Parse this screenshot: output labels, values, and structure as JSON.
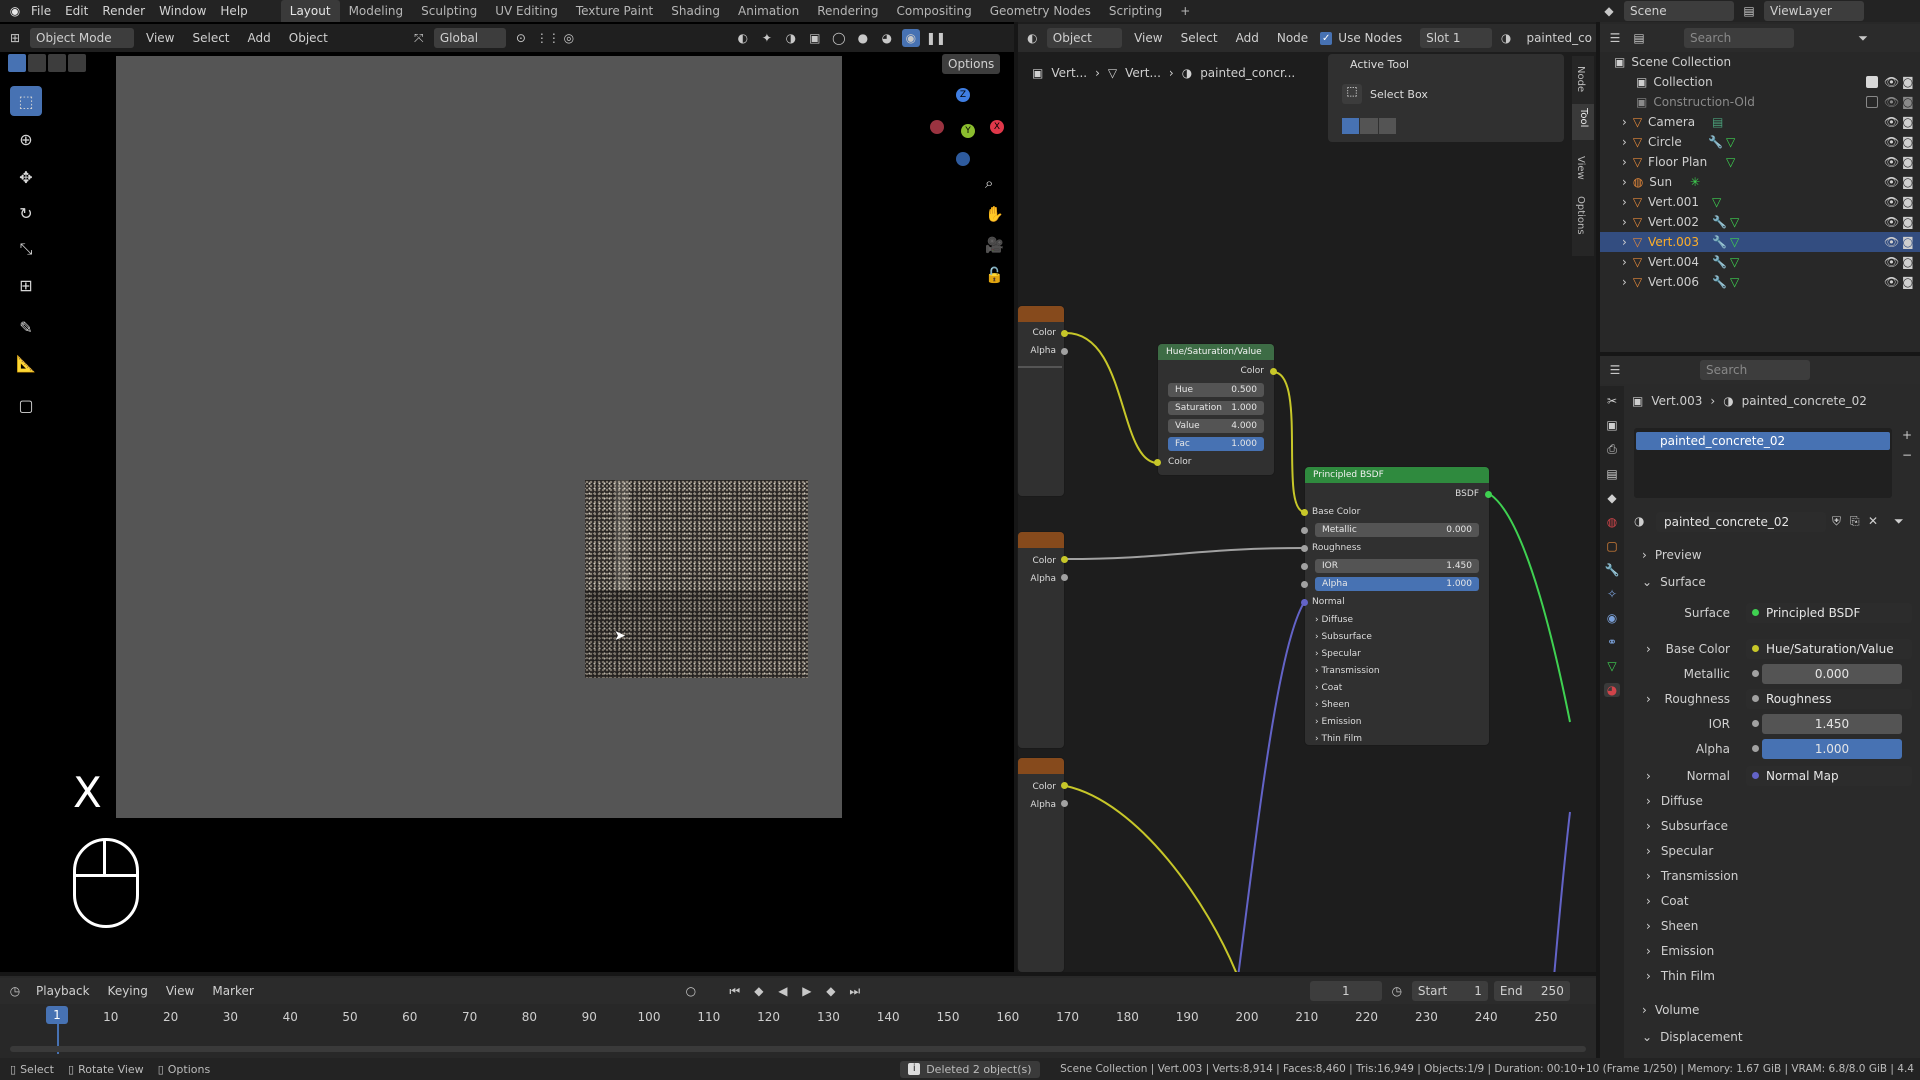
{
  "menus": [
    "File",
    "Edit",
    "Render",
    "Window",
    "Help"
  ],
  "workspaces": [
    "Layout",
    "Modeling",
    "Sculpting",
    "UV Editing",
    "Texture Paint",
    "Shading",
    "Animation",
    "Rendering",
    "Compositing",
    "Geometry Nodes",
    "Scripting"
  ],
  "scene_name": "Scene",
  "view_layer": "ViewLayer",
  "viewport": {
    "mode": "Object Mode",
    "menus": [
      "View",
      "Select",
      "Add",
      "Object"
    ],
    "transform": "Global",
    "options_label": "Options",
    "key_overlay": "X"
  },
  "node_editor": {
    "type": "Object",
    "menus": [
      "View",
      "Select",
      "Add",
      "Node"
    ],
    "use_nodes_label": "Use Nodes",
    "slot": "Slot 1",
    "material_short": "painted_co",
    "breadcrumb": [
      "Vert...",
      "Vert...",
      "painted_concr..."
    ],
    "tabs": [
      "Node",
      "Tool",
      "View",
      "Options"
    ],
    "active_tool": {
      "title": "Active Tool",
      "tool": "Select Box"
    },
    "texture_sockets": {
      "color": "Color",
      "alpha": "Alpha"
    },
    "hsv": {
      "title": "Hue/Saturation/Value",
      "out": "Color",
      "in_color": "Color",
      "fields": [
        {
          "label": "Hue",
          "value": "0.500"
        },
        {
          "label": "Saturation",
          "value": "1.000"
        },
        {
          "label": "Value",
          "value": "4.000"
        },
        {
          "label": "Fac",
          "value": "1.000"
        }
      ]
    },
    "bsdf": {
      "title": "Principled BSDF",
      "out": "BSDF",
      "base_color": "Base Color",
      "metallic": "Metallic",
      "metallic_value": "0.000",
      "roughness": "Roughness",
      "ior": "IOR",
      "ior_value": "1.450",
      "alpha": "Alpha",
      "alpha_value": "1.000",
      "normal": "Normal",
      "panels": [
        "Diffuse",
        "Subsurface",
        "Specular",
        "Transmission",
        "Coat",
        "Sheen",
        "Emission",
        "Thin Film"
      ]
    }
  },
  "outliner": {
    "search_placeholder": "Search",
    "root": "Scene Collection",
    "items": [
      {
        "name": "Collection"
      },
      {
        "name": "Construction-Old"
      },
      {
        "name": "Camera"
      },
      {
        "name": "Circle"
      },
      {
        "name": "Floor Plan"
      },
      {
        "name": "Sun"
      },
      {
        "name": "Vert.001"
      },
      {
        "name": "Vert.002"
      },
      {
        "name": "Vert.003"
      },
      {
        "name": "Vert.004"
      },
      {
        "name": "Vert.006"
      }
    ]
  },
  "properties": {
    "search_placeholder": "Search",
    "breadcrumb_object": "Vert.003",
    "breadcrumb_material": "painted_concrete_02",
    "slot_material": "painted_concrete_02",
    "material_name": "painted_concrete_02",
    "sections": {
      "preview": "Preview",
      "surface": "Surface",
      "volume": "Volume",
      "displacement": "Displacement"
    },
    "surface_label": "Surface",
    "surface_value": "Principled BSDF",
    "base_color_label": "Base Color",
    "base_color_value": "Hue/Saturation/Value",
    "metallic_label": "Metallic",
    "metallic_value": "0.000",
    "roughness_label": "Roughness",
    "roughness_value": "Roughness",
    "ior_label": "IOR",
    "ior_value": "1.450",
    "alpha_label": "Alpha",
    "alpha_value": "1.000",
    "normal_label": "Normal",
    "normal_value": "Normal Map",
    "subpanels": [
      "Diffuse",
      "Subsurface",
      "Specular",
      "Transmission",
      "Coat",
      "Sheen",
      "Emission",
      "Thin Film"
    ]
  },
  "timeline": {
    "menus": [
      "Playback",
      "Keying",
      "View",
      "Marker"
    ],
    "current_frame": "1",
    "start_label": "Start",
    "start": "1",
    "end_label": "End",
    "end": "250",
    "ticks": [
      "1",
      "10",
      "20",
      "30",
      "40",
      "50",
      "60",
      "70",
      "80",
      "90",
      "100",
      "110",
      "120",
      "130",
      "140",
      "150",
      "160",
      "170",
      "180",
      "190",
      "200",
      "210",
      "220",
      "230",
      "240",
      "250"
    ]
  },
  "status": {
    "select": "Select",
    "rotate": "Rotate View",
    "options": "Options",
    "message": "Deleted 2 object(s)",
    "info": "Scene Collection | Vert.003 | Verts:8,914 | Faces:8,460 | Tris:16,949 | Objects:1/9 | Duration: 00:10+10 (Frame 1/250) | Memory: 1.67 GiB | VRAM: 6.8/8.0 GiB | 4.4"
  },
  "colors": {
    "accent": "#4772b3",
    "bsdf_header": "#2f8a3e",
    "hsv_header": "#3d6c45",
    "texture_header": "#864a1c",
    "socket_yellow": "#c7c729",
    "socket_green": "#3fd151",
    "socket_grey": "#a1a1a1",
    "socket_purple": "#6363c7"
  }
}
